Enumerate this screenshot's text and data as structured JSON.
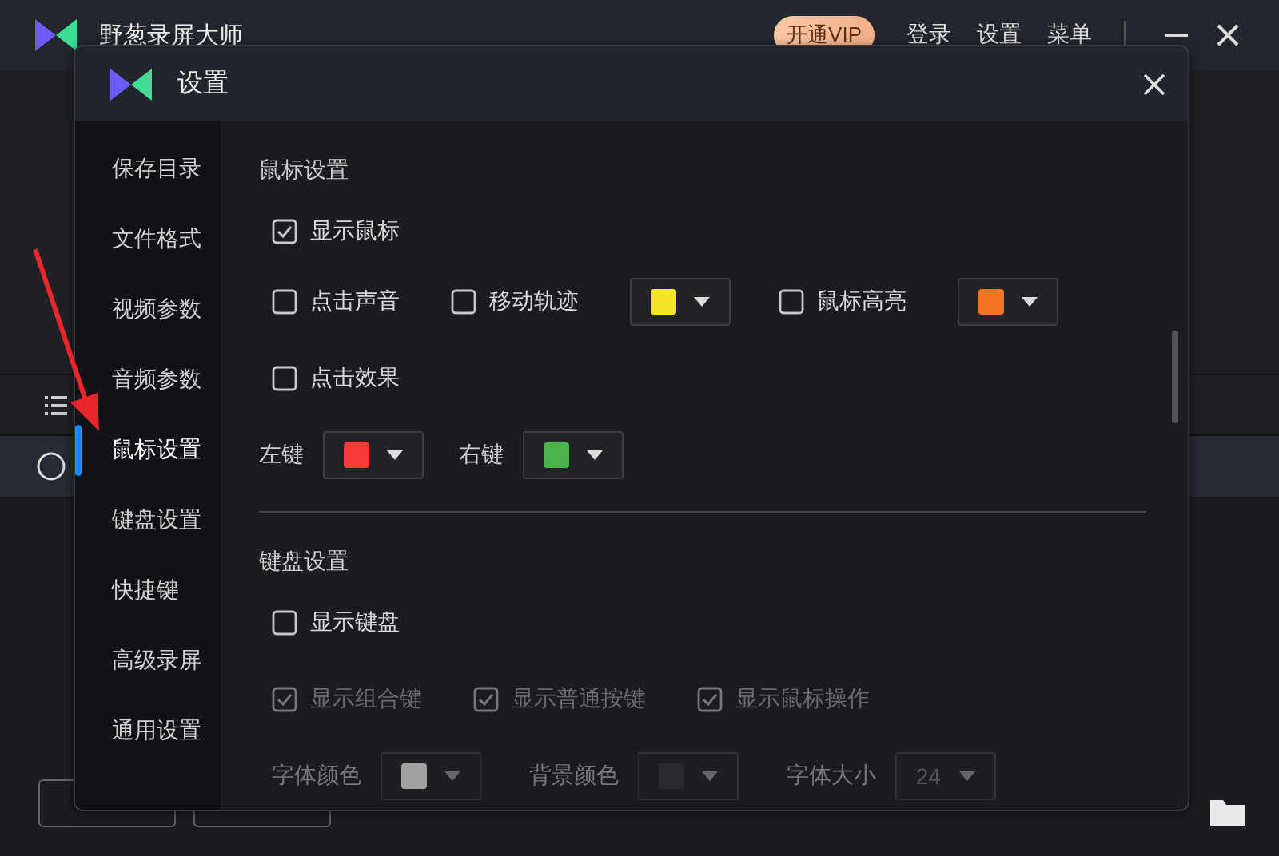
{
  "app": {
    "title": "野葱录屏大师",
    "vip_button": "开通VIP",
    "menu": [
      "登录",
      "设置",
      "菜单"
    ]
  },
  "dialog": {
    "title": "设置",
    "sidebar": [
      {
        "label": "保存目录",
        "selected": false
      },
      {
        "label": "文件格式",
        "selected": false
      },
      {
        "label": "视频参数",
        "selected": false
      },
      {
        "label": "音频参数",
        "selected": false
      },
      {
        "label": "鼠标设置",
        "selected": true
      },
      {
        "label": "键盘设置",
        "selected": false
      },
      {
        "label": "快捷键",
        "selected": false
      },
      {
        "label": "高级录屏",
        "selected": false
      },
      {
        "label": "通用设置",
        "selected": false
      }
    ],
    "sections": [
      {
        "title": "鼠标设置",
        "rows": [
          [
            {
              "kind": "checkbox",
              "label": "显示鼠标",
              "checked": true,
              "disabled": false
            }
          ],
          [
            {
              "kind": "checkbox",
              "label": "点击声音",
              "checked": false,
              "disabled": false
            },
            {
              "kind": "checkbox",
              "label": "移动轨迹",
              "checked": false,
              "disabled": false
            },
            {
              "kind": "color",
              "color": "#f5e52a",
              "disabled": false
            },
            {
              "kind": "checkbox",
              "label": "鼠标高亮",
              "checked": false,
              "disabled": false
            },
            {
              "kind": "color",
              "color": "#f57224",
              "disabled": false
            }
          ],
          [
            {
              "kind": "checkbox",
              "label": "点击效果",
              "checked": false,
              "disabled": false
            }
          ],
          [
            {
              "kind": "color",
              "label": "左键",
              "color": "#f53a3a",
              "disabled": false
            },
            {
              "kind": "color",
              "label": "右键",
              "color": "#4caf50",
              "disabled": false
            }
          ]
        ]
      },
      {
        "title": "键盘设置",
        "rows": [
          [
            {
              "kind": "checkbox",
              "label": "显示键盘",
              "checked": false,
              "disabled": false
            }
          ],
          [
            {
              "kind": "checkbox",
              "label": "显示组合键",
              "checked": true,
              "disabled": true
            },
            {
              "kind": "checkbox",
              "label": "显示普通按键",
              "checked": true,
              "disabled": true
            },
            {
              "kind": "checkbox",
              "label": "显示鼠标操作",
              "checked": true,
              "disabled": true
            }
          ],
          [
            {
              "kind": "color",
              "label": "字体颜色",
              "color": "#a0a0a0",
              "disabled": true
            },
            {
              "kind": "color",
              "label": "背景颜色",
              "color": "#2a2b2f",
              "disabled": true
            },
            {
              "kind": "select",
              "label": "字体大小",
              "value": "24",
              "disabled": true
            }
          ]
        ]
      }
    ]
  }
}
